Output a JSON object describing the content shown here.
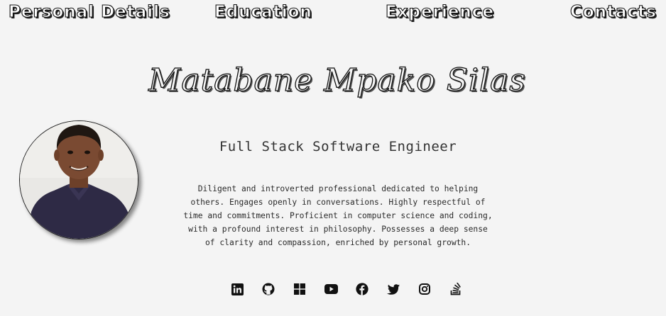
{
  "nav": {
    "items": [
      {
        "label": "Personal Details"
      },
      {
        "label": "Education"
      },
      {
        "label": "Experience"
      },
      {
        "label": "Contacts"
      }
    ]
  },
  "profile": {
    "name": "Matabane Mpako Silas",
    "role": "Full Stack Software Engineer",
    "bio": "Diligent and introverted professional dedicated to helping\nothers. Engages openly in conversations. Highly respectful of\ntime and commitments. Proficient in computer science and coding,\nwith a profound interest in philosophy. Possesses a deep sense\nof clarity and compassion, enriched by personal growth."
  },
  "socials": [
    {
      "icon": "linkedin-icon"
    },
    {
      "icon": "github-icon"
    },
    {
      "icon": "windows-icon"
    },
    {
      "icon": "youtube-icon"
    },
    {
      "icon": "facebook-icon"
    },
    {
      "icon": "twitter-icon"
    },
    {
      "icon": "instagram-icon"
    },
    {
      "icon": "stackoverflow-icon"
    }
  ],
  "colors": {
    "background": "#f4f4f4",
    "text": "#1a1a1a",
    "shirt": "#2e2a45",
    "skin": "#7a4a32"
  }
}
